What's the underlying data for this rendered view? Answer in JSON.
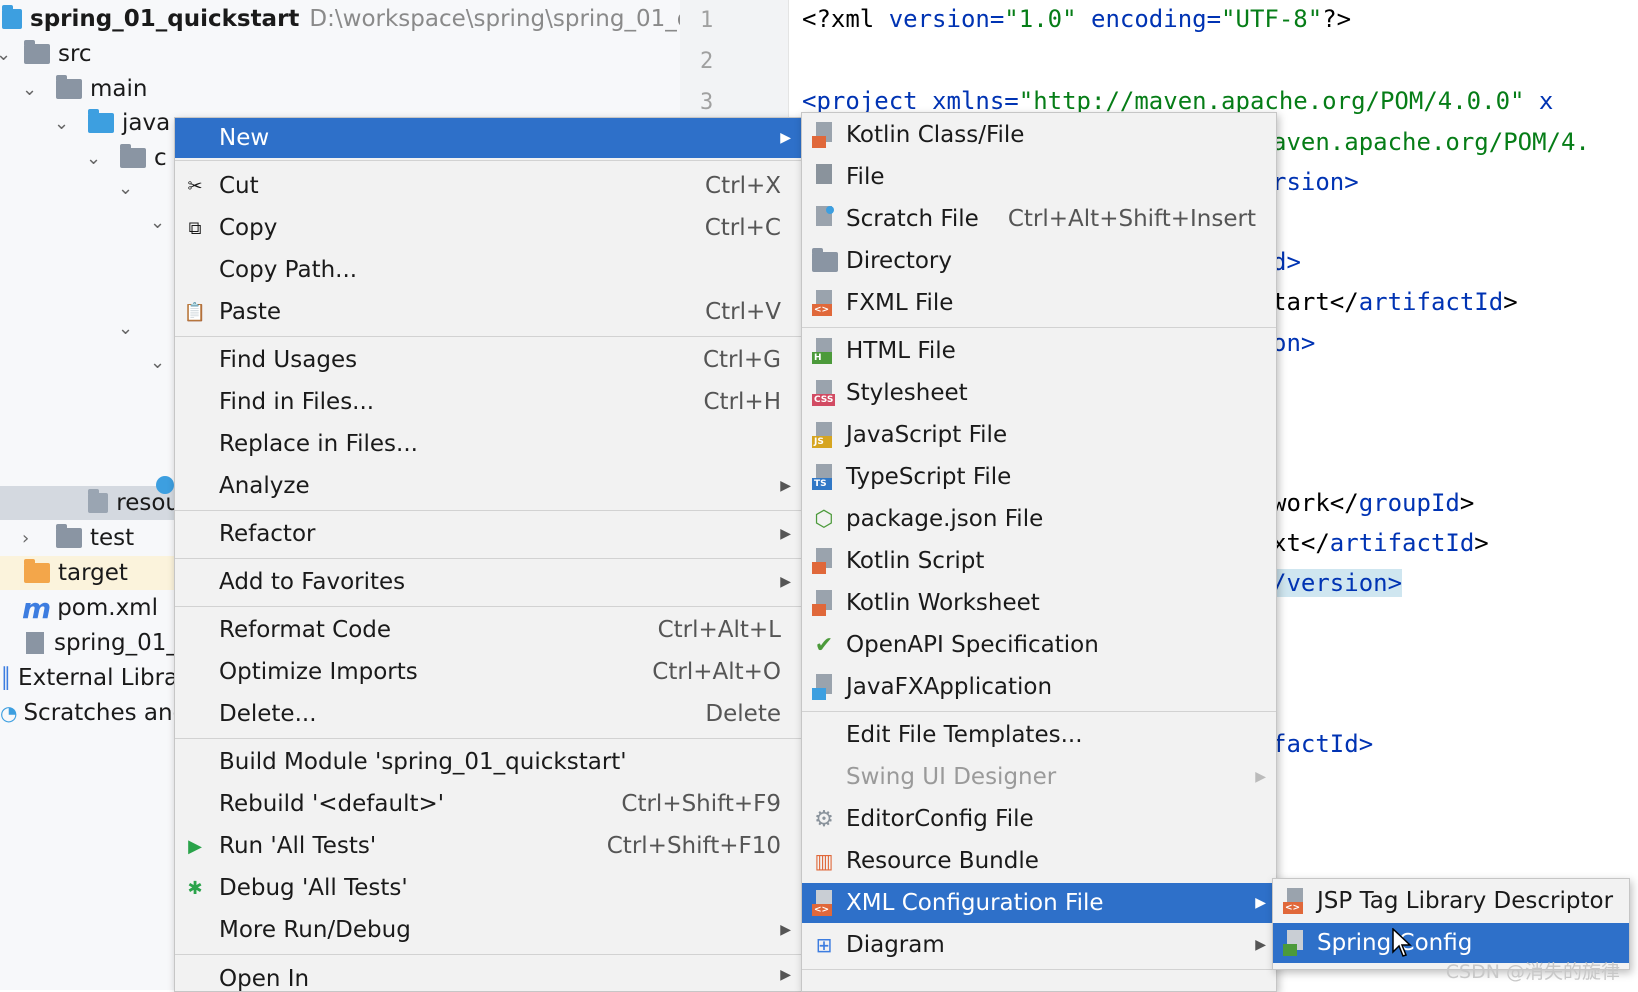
{
  "project": {
    "name": "spring_01_quickstart",
    "path": "D:\\workspace\\spring\\spring_01_quic",
    "tree": {
      "src": "src",
      "main": "main",
      "java": "java",
      "c1": "c",
      "resources": "resou",
      "test": "test",
      "target": "target",
      "pom": "pom.xml",
      "iml": "spring_01_",
      "external": "External Libra",
      "scratches": "Scratches anc"
    }
  },
  "editor": {
    "line_numbers": [
      "1",
      "2",
      "3"
    ],
    "l1_a": "<?xml ",
    "l1_b": "version=",
    "l1_c": "\"1.0\" ",
    "l1_d": "encoding=",
    "l1_e": "\"UTF-8\"",
    "l1_f": "?>",
    "l3_a": "<project ",
    "l3_b": "xmlns=",
    "l3_c": "\"http://maven.apache.org/POM/4.0.0\" ",
    "l3_d": "x",
    "frag1": "aven.apache.org/POM/4.",
    "frag2": "rsion>",
    "frag3": "d>",
    "frag4a": "tart</",
    "frag4b": "artifactId",
    "frag4c": ">",
    "frag5": "on>",
    "frag6a": "work</",
    "frag6b": "groupId",
    "frag6c": ">",
    "frag7a": "xt</",
    "frag7b": "artifactId",
    "frag7c": ">",
    "frag8": "/version>",
    "frag9": "factId>"
  },
  "context_menu": {
    "new": "New",
    "cut": "Cut",
    "cut_sc": "Ctrl+X",
    "copy": "Copy",
    "copy_sc": "Ctrl+C",
    "copy_path": "Copy Path...",
    "paste": "Paste",
    "paste_sc": "Ctrl+V",
    "find_usages": "Find Usages",
    "find_usages_sc": "Ctrl+G",
    "find_files": "Find in Files...",
    "find_files_sc": "Ctrl+H",
    "replace_files": "Replace in Files...",
    "analyze": "Analyze",
    "refactor": "Refactor",
    "favorites": "Add to Favorites",
    "reformat": "Reformat Code",
    "reformat_sc": "Ctrl+Alt+L",
    "optimize": "Optimize Imports",
    "optimize_sc": "Ctrl+Alt+O",
    "delete": "Delete...",
    "delete_sc": "Delete",
    "build": "Build Module 'spring_01_quickstart'",
    "rebuild": "Rebuild '<default>'",
    "rebuild_sc": "Ctrl+Shift+F9",
    "run": "Run 'All Tests'",
    "run_sc": "Ctrl+Shift+F10",
    "debug": "Debug 'All Tests'",
    "more_run": "More Run/Debug",
    "open_in": "Open In"
  },
  "new_menu": {
    "kotlin_class": "Kotlin Class/File",
    "file": "File",
    "scratch": "Scratch File",
    "scratch_sc": "Ctrl+Alt+Shift+Insert",
    "directory": "Directory",
    "fxml": "FXML File",
    "html": "HTML File",
    "stylesheet": "Stylesheet",
    "javascript": "JavaScript File",
    "typescript": "TypeScript File",
    "package_json": "package.json File",
    "kotlin_script": "Kotlin Script",
    "kotlin_worksheet": "Kotlin Worksheet",
    "openapi": "OpenAPI Specification",
    "javafx": "JavaFXApplication",
    "edit_templates": "Edit File Templates...",
    "swing": "Swing UI Designer",
    "editorconfig": "EditorConfig File",
    "resource_bundle": "Resource Bundle",
    "xml_config": "XML Configuration File",
    "diagram": "Diagram"
  },
  "xml_menu": {
    "jsp_tag": "JSP Tag Library Descriptor",
    "spring_config": "Spring Config"
  },
  "icon_badges": {
    "fxml": "<>",
    "html": "H",
    "css": "CSS",
    "js": "JS",
    "ts": "TS",
    "xml": "<>"
  },
  "watermark": "CSDN @消失的旋律",
  "colors": {
    "selection": "#2e70c9",
    "menu_bg": "#f2f2f2",
    "tree_bg": "#f7f8fa"
  }
}
